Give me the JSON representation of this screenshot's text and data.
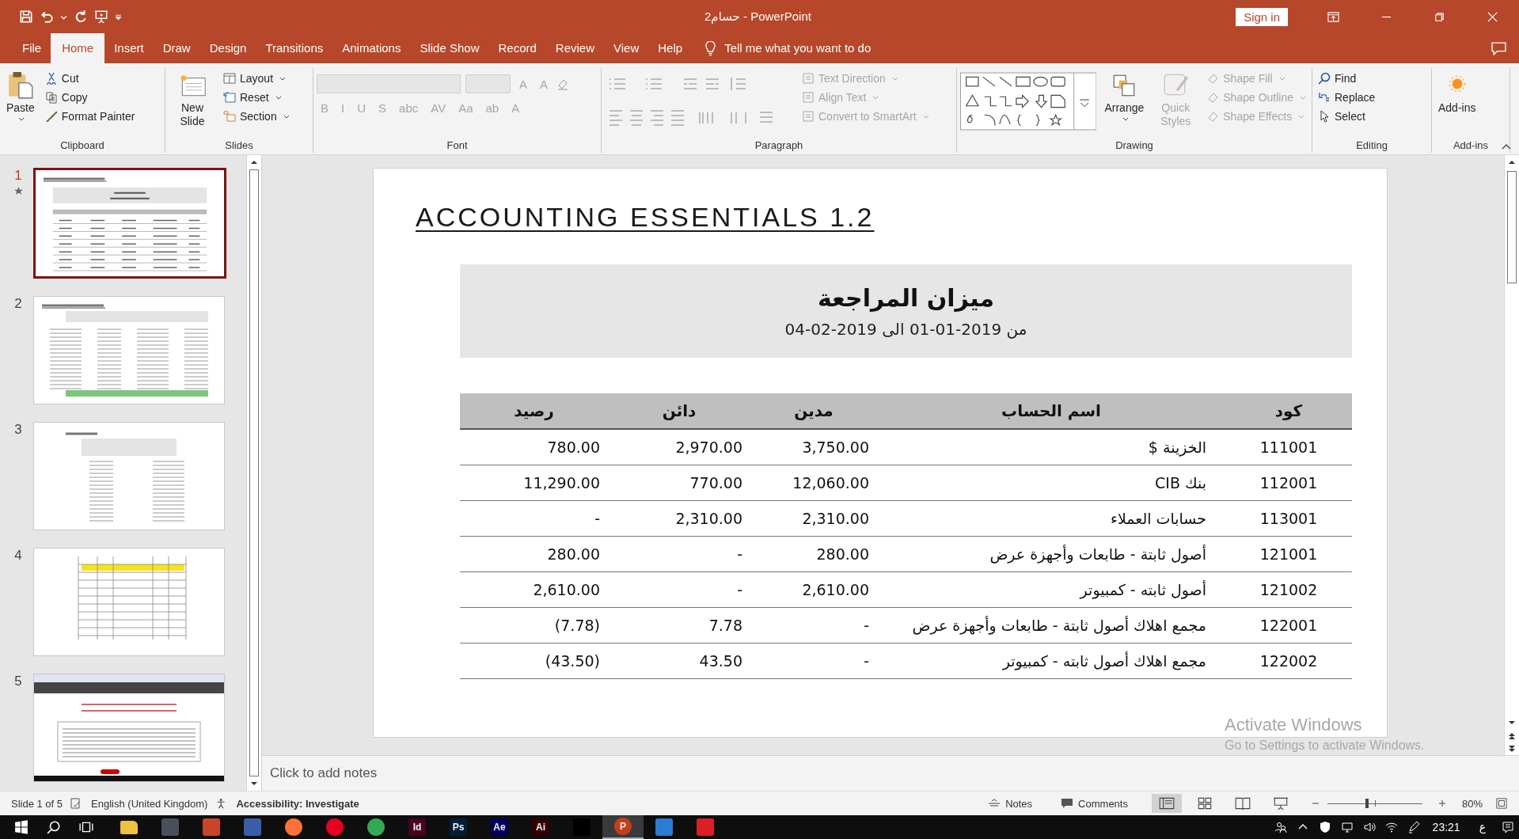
{
  "window": {
    "title": "حسام2  -  PowerPoint",
    "sign_in": "Sign in"
  },
  "tabs": [
    {
      "label": "File",
      "selected": false
    },
    {
      "label": "Home",
      "selected": true
    },
    {
      "label": "Insert",
      "selected": false
    },
    {
      "label": "Draw",
      "selected": false
    },
    {
      "label": "Design",
      "selected": false
    },
    {
      "label": "Transitions",
      "selected": false
    },
    {
      "label": "Animations",
      "selected": false
    },
    {
      "label": "Slide Show",
      "selected": false
    },
    {
      "label": "Record",
      "selected": false
    },
    {
      "label": "Review",
      "selected": false
    },
    {
      "label": "View",
      "selected": false
    },
    {
      "label": "Help",
      "selected": false
    }
  ],
  "tell_me": {
    "placeholder": "Tell me what you want to do"
  },
  "ribbon": {
    "clipboard": {
      "label": "Clipboard",
      "paste": "Paste",
      "items": [
        {
          "label": "Cut",
          "kind": "cut"
        },
        {
          "label": "Copy",
          "kind": "copy"
        },
        {
          "label": "Format Painter",
          "kind": "painter"
        }
      ]
    },
    "slides": {
      "label": "Slides",
      "new_slide": "New Slide",
      "items": [
        {
          "label": "Layout",
          "kind": "layout"
        },
        {
          "label": "Reset",
          "kind": "reset"
        },
        {
          "label": "Section",
          "kind": "section"
        }
      ]
    },
    "font": {
      "label": "Font",
      "disabled": true,
      "size_buttons": [
        "A",
        "A"
      ],
      "format_buttons": [
        "B",
        "I",
        "U",
        "S",
        "abc",
        "AV",
        "Aa",
        "ab",
        "A"
      ]
    },
    "paragraph": {
      "label": "Paragraph",
      "items": [
        {
          "label": "Text Direction",
          "disabled": true
        },
        {
          "label": "Align Text",
          "disabled": true
        },
        {
          "label": "Convert to SmartArt",
          "disabled": true
        }
      ]
    },
    "drawing": {
      "label": "Drawing",
      "arrange": "Arrange",
      "quick_styles": {
        "label": "Quick Styles",
        "disabled": true
      },
      "items": [
        {
          "label": "Shape Fill",
          "disabled": true
        },
        {
          "label": "Shape Outline",
          "disabled": true
        },
        {
          "label": "Shape Effects",
          "disabled": true
        }
      ]
    },
    "editing": {
      "label": "Editing",
      "items": [
        {
          "label": "Find",
          "kind": "find"
        },
        {
          "label": "Replace",
          "kind": "replace"
        },
        {
          "label": "Select",
          "kind": "select"
        }
      ]
    },
    "addins": {
      "label": "Add-ins",
      "button": "Add-ins"
    }
  },
  "thumbnails": [
    {
      "number": "1",
      "selected": true,
      "kind": "table"
    },
    {
      "number": "2",
      "selected": false,
      "kind": "report"
    },
    {
      "number": "3",
      "selected": false,
      "kind": "statement"
    },
    {
      "number": "4",
      "selected": false,
      "kind": "sheet"
    },
    {
      "number": "5",
      "selected": false,
      "kind": "web"
    }
  ],
  "slide": {
    "title": "ACCOUNTING ESSENTIALS 1.2",
    "heading": "ميزان المراجعة",
    "period": "من 2019-01-01 الى 2019-02-04",
    "columns": [
      "رصيد",
      "دائن",
      "مدين",
      "اسم الحساب",
      "كود"
    ],
    "rows": [
      [
        "780.00",
        "2,970.00",
        "3,750.00",
        "الخزينة $",
        "111001"
      ],
      [
        "11,290.00",
        "770.00",
        "12,060.00",
        "بنك CIB",
        "112001"
      ],
      [
        "-",
        "2,310.00",
        "2,310.00",
        "حسابات العملاء",
        "113001"
      ],
      [
        "280.00",
        "-",
        "280.00",
        "أصول ثابتة - طابعات وأجهزة عرض",
        "121001"
      ],
      [
        "2,610.00",
        "-",
        "2,610.00",
        "أصول ثابته - كمبيوتر",
        "121002"
      ],
      [
        "(7.78)",
        "7.78",
        "-",
        "مجمع اهلاك أصول ثابتة - طابعات وأجهزة عرض",
        "122001"
      ],
      [
        "(43.50)",
        "43.50",
        "-",
        "مجمع اهلاك أصول ثابته - كمبيوتر",
        "122002"
      ]
    ]
  },
  "notes": {
    "placeholder": "Click to add notes"
  },
  "activation": {
    "title": "Activate Windows",
    "subtitle": "Go to Settings to activate Windows."
  },
  "status_bar": {
    "slide": "Slide 1 of 5",
    "language": "English (United Kingdom)",
    "accessibility": "Accessibility: Investigate",
    "notes": "Notes",
    "comments": "Comments",
    "zoom": "80%",
    "zoom_level": {
      "level": 0.42
    }
  },
  "taskbar": {
    "apps": [
      {
        "kind": "folder",
        "color": "#f0c040",
        "selected": false
      },
      {
        "kind": "tile",
        "color": "#4a4f5c",
        "selected": false
      },
      {
        "kind": "tile",
        "color": "#c8442c",
        "selected": false
      },
      {
        "kind": "tile",
        "color": "#3a5fa8",
        "selected": false
      },
      {
        "kind": "circle",
        "color": "#ff7139",
        "selected": false
      },
      {
        "kind": "circle",
        "color": "#e60023",
        "selected": false
      },
      {
        "kind": "circle",
        "color": "#34a853",
        "selected": false
      },
      {
        "kind": "tile",
        "color": "#49021f",
        "label": "Id",
        "selected": false
      },
      {
        "kind": "tile",
        "color": "#001e36",
        "label": "Ps",
        "selected": false
      },
      {
        "kind": "tile",
        "color": "#00005b",
        "label": "Ae",
        "selected": false
      },
      {
        "kind": "tile",
        "color": "#330000",
        "label": "Ai",
        "selected": false
      },
      {
        "kind": "tile",
        "color": "#000000",
        "selected": false
      },
      {
        "kind": "circle",
        "color": "#c43e1c",
        "label": "P",
        "selected": true
      },
      {
        "kind": "tile",
        "color": "#2b7cd3",
        "selected": false
      },
      {
        "kind": "tile",
        "color": "#da1f26",
        "selected": false
      }
    ],
    "time": "23:21",
    "language": "ع"
  }
}
